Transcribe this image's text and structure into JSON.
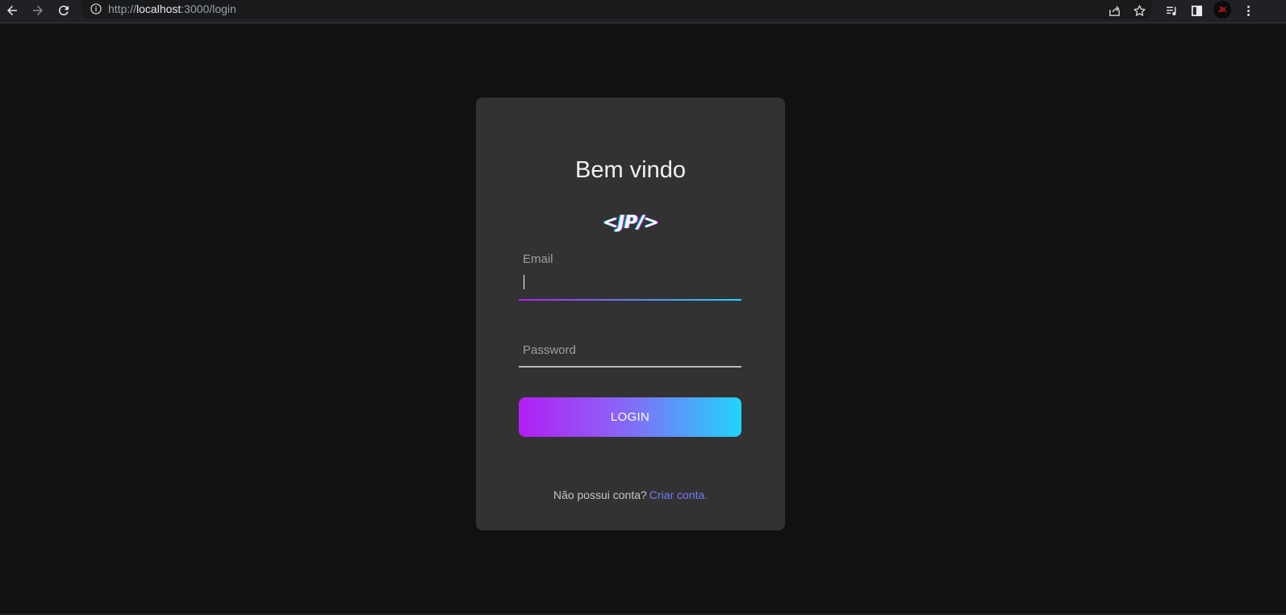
{
  "browser": {
    "url_scheme": "http://",
    "url_host": "localhost",
    "url_path": ":3000/login",
    "profile_initials": "JK",
    "icons": [
      "back-icon",
      "forward-icon",
      "reload-icon",
      "info-icon",
      "share-icon",
      "star-icon",
      "reading-list-icon",
      "side-panel-icon",
      "menu-icon"
    ]
  },
  "login": {
    "title": "Bem vindo",
    "logo_text": "<JP/>",
    "email_label": "Email",
    "email_value": "",
    "password_label": "Password",
    "password_value": "",
    "login_button": "LOGIN",
    "no_account_text": "Não possui conta?",
    "create_account_link": "Criar conta."
  },
  "colors": {
    "background": "#111111",
    "card": "#323232",
    "gradient_start": "#b21ff5",
    "gradient_end": "#21d4fd",
    "link": "#7b78f5"
  }
}
